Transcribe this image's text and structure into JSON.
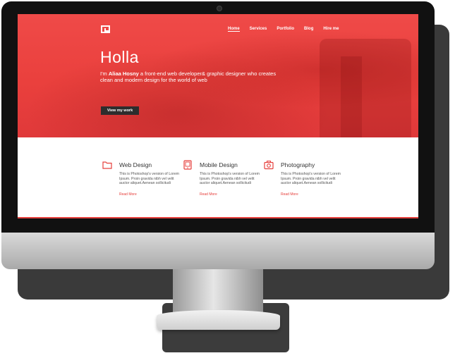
{
  "nav": {
    "items": [
      {
        "label": "Home",
        "active": true
      },
      {
        "label": "Services",
        "active": false
      },
      {
        "label": "Portfolio",
        "active": false
      },
      {
        "label": "Blog",
        "active": false
      },
      {
        "label": "Hire me",
        "active": false
      }
    ]
  },
  "hero": {
    "title": "Holla",
    "sub_prefix": "I'm ",
    "sub_name": "Aliaa Hosny",
    "sub_rest": " a front-end web developer& graphic designer who creates clean and modern design for the world of web",
    "button_label": "View my work"
  },
  "services": [
    {
      "icon": "folder-icon",
      "title": "Web Design",
      "text": "This is Photoshop's version of Lorem Ipsum. Proin gravida nibh vel velit auctor aliquet.Aenean sollicitudi",
      "link": "Read More"
    },
    {
      "icon": "tablet-icon",
      "title": "Mobile Design",
      "text": "This is Photoshop's version of Lorem Ipsum. Proin gravida nibh vel velit auctor aliquet.Aenean sollicitudi",
      "link": "Read More"
    },
    {
      "icon": "camera-icon",
      "title": "Photography",
      "text": "This is Photoshop's version of Lorem Ipsum. Proin gravida nibh vel velit auctor aliquet.Aenean sollicitudi",
      "link": "Read More"
    }
  ],
  "colors": {
    "accent": "#e6403d",
    "button_bg": "#2d2d2d"
  }
}
